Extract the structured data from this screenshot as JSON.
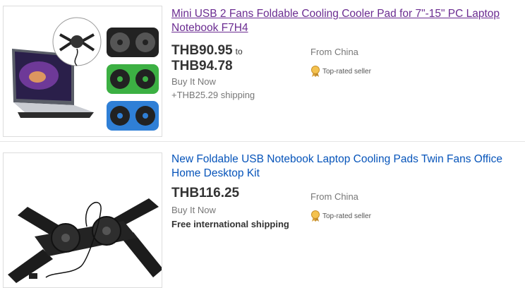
{
  "listings": [
    {
      "title": "Mini USB 2 Fans Foldable Cooling Cooler Pad for 7\"-15\" PC Laptop Notebook F7H4",
      "price": "THB90.95",
      "price_to_label": "to",
      "price_max": "THB94.78",
      "format": "Buy It Now",
      "shipping": "+THB25.29 shipping",
      "location": "From China",
      "seller_badge": "Top-rated seller",
      "image_icon": "laptop-cooler-pad-product-image",
      "colors": {
        "link_visited": "#6b2c91",
        "fan_black": "#222222",
        "fan_green": "#3cb043",
        "fan_blue": "#2f7fd6"
      }
    },
    {
      "title": "New Foldable USB Notebook Laptop Cooling Pads Twin Fans Office Home Desktop Kit",
      "price": "THB116.25",
      "format": "Buy It Now",
      "shipping": "Free international shipping",
      "location": "From China",
      "seller_badge": "Top-rated seller",
      "image_icon": "foldable-twin-fan-stand-product-image",
      "colors": {
        "link": "#0654ba",
        "stand": "#1c1c1c"
      }
    }
  ]
}
